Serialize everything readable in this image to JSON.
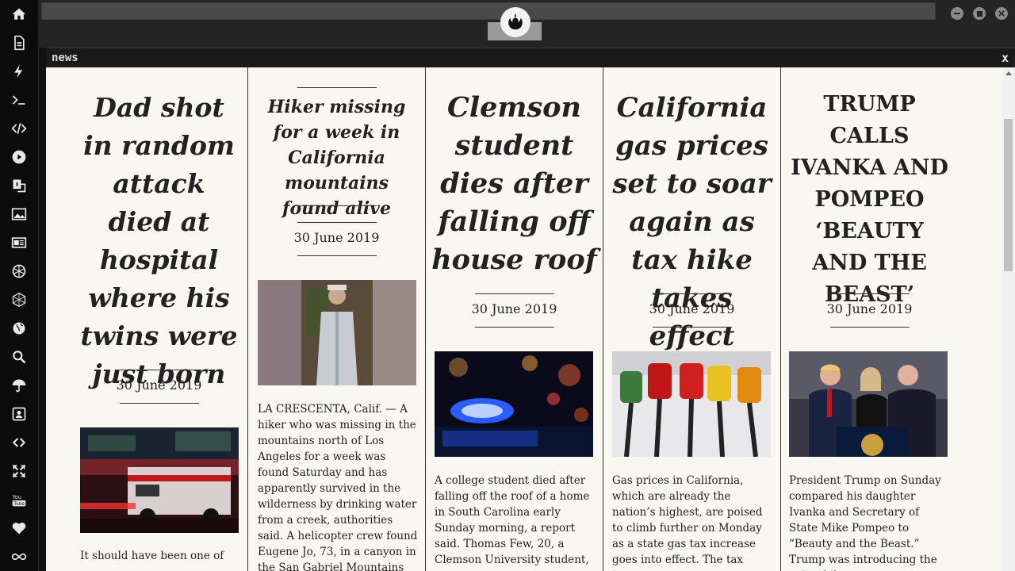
{
  "sidebar": {
    "icons": [
      "home-icon",
      "document-icon",
      "bolt-icon",
      "terminal-icon",
      "code-icon",
      "play-icon",
      "translate-icon",
      "image-icon",
      "news-icon",
      "aperture-icon",
      "hexagon-icon",
      "globe-icon",
      "search-icon",
      "umbrella-icon",
      "contact-icon",
      "link-icon",
      "expand-icon",
      "youtube-icon",
      "heart-icon",
      "infinity-icon"
    ]
  },
  "panel": {
    "title": "news",
    "close_label": "x"
  },
  "articles": [
    {
      "headline": "Dad shot in random attack died at hospital where his twins were just born",
      "date": "30 June 2019",
      "body": "It should have been one of"
    },
    {
      "headline": "Hiker missing for a week in California mountains found alive",
      "date": "30 June 2019",
      "body": "LA CRESCENTA, Calif. — A hiker who was missing in the mountains north of Los Angeles for a week was found Saturday and has apparently survived in the wilderness by drinking water from a creek, authorities said. A helicopter crew found Eugene Jo, 73, in a canyon in the San Gabriel Mountains and hoisted him"
    },
    {
      "headline": "Clemson student dies after falling off house roof",
      "date": "30 June 2019",
      "body": "A college student died after falling off the roof of a home in South Carolina early Sunday morning, a report said. Thomas Few, 20, a Clemson University student,"
    },
    {
      "headline": "California gas prices set to soar again as tax hike takes effect",
      "date": "30 June 2019",
      "body": "Gas prices in California, which are already the nation’s highest, are poised to climb further on Monday as a state gas tax increase goes into effect. The tax increase"
    },
    {
      "headline": "TRUMP CALLS IVANKA AND POMPEO ‘BEAUTY AND THE BEAST’",
      "date": "30 June 2019",
      "body": "President Trump on Sunday compared his daughter Ivanka and Secretary of State Mike Pompeo to “Beauty and the Beast.” Trump was introducing the pair while"
    }
  ]
}
